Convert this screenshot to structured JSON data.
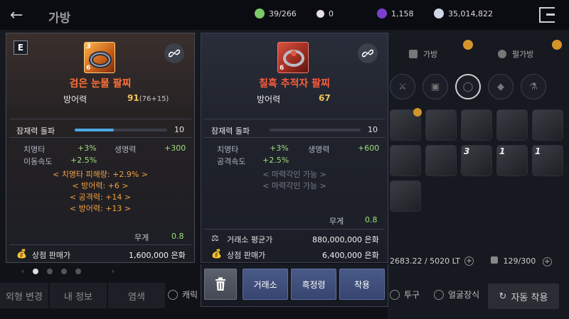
{
  "topbar": {
    "title": "가방",
    "currencies": [
      {
        "icon": "green-gem-icon",
        "value": "39/266",
        "color": "#7bc96a"
      },
      {
        "icon": "pearl-icon",
        "value": "0",
        "color": "#e8e0e6"
      },
      {
        "icon": "purple-crystal-icon",
        "value": "1,158",
        "color": "#7a3fd0"
      },
      {
        "icon": "silver-coin-icon",
        "value": "35,014,822",
        "color": "#cfd6e6"
      }
    ]
  },
  "background": {
    "tabs": [
      "가방",
      "펄가방"
    ],
    "weight": "2683.22 / 5020 LT",
    "slots": "129/300",
    "auto_equip": "자동 착용",
    "checks": [
      "캐릭",
      "투구",
      "얼굴장식"
    ],
    "bottom_buttons": [
      "외형 변경",
      "내 정보",
      "염색"
    ]
  },
  "left_card": {
    "tier": "E",
    "count": "3",
    "level": "6",
    "name": "검은 눈물 팔찌",
    "main_stat_label": "방어력",
    "main_stat_value": "91",
    "main_stat_detail": "(76+15)",
    "potential_label": "잠재력 돌파",
    "potential_value": "10",
    "potential_fill": 0.42,
    "stats": [
      {
        "k": "치명타",
        "v": "+3%"
      },
      {
        "k": "생명력",
        "v": "+300"
      },
      {
        "k": "이동속도",
        "v": "+2.5%"
      }
    ],
    "special": [
      "< 치명타 피해량: +2.9% >",
      "< 방어력: +6 >",
      "< 공격력: +14 >",
      "< 방어력: +13 >"
    ],
    "weight_label": "무게",
    "weight_value": "0.8",
    "shop_label": "상점 판매가",
    "shop_value": "1,600,000 은화"
  },
  "right_card": {
    "level": "6",
    "name": "칠흑 추적자 팔찌",
    "main_stat_label": "방어력",
    "main_stat_value": "67",
    "potential_label": "잠재력 돌파",
    "potential_value": "10",
    "potential_fill": 0.0,
    "stats": [
      {
        "k": "치명타",
        "v": "+3%"
      },
      {
        "k": "생명력",
        "v": "+600"
      },
      {
        "k": "공격속도",
        "v": "+2.5%"
      }
    ],
    "slots": [
      "< 마력각인 가능 >",
      "< 마력각인 가능 >"
    ],
    "weight_label": "무게",
    "weight_value": "0.8",
    "market_label": "거래소 평균가",
    "market_value": "880,000,000 은화",
    "shop_label": "상점 판매가",
    "shop_value": "6,400,000 은화"
  },
  "actions": {
    "trade": "거래소",
    "refine": "흑정령",
    "equip": "착용"
  }
}
